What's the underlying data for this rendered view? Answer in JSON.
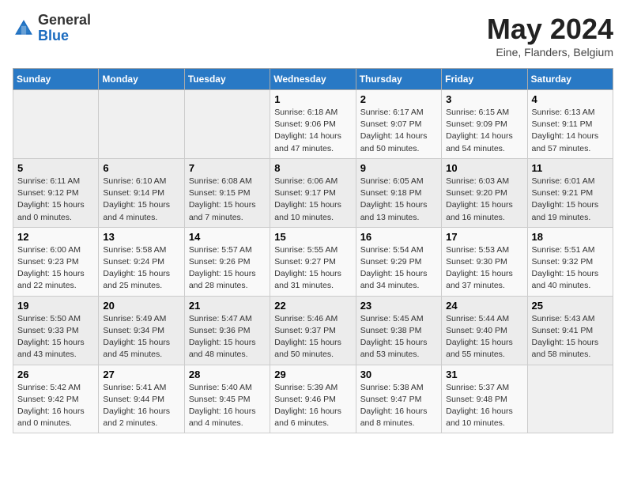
{
  "header": {
    "logo_general": "General",
    "logo_blue": "Blue",
    "main_title": "May 2024",
    "subtitle": "Eine, Flanders, Belgium"
  },
  "weekdays": [
    "Sunday",
    "Monday",
    "Tuesday",
    "Wednesday",
    "Thursday",
    "Friday",
    "Saturday"
  ],
  "rows": [
    [
      {
        "day": "",
        "empty": true
      },
      {
        "day": "",
        "empty": true
      },
      {
        "day": "",
        "empty": true
      },
      {
        "day": "1",
        "sunrise": "6:18 AM",
        "sunset": "9:06 PM",
        "daylight": "14 hours and 47 minutes."
      },
      {
        "day": "2",
        "sunrise": "6:17 AM",
        "sunset": "9:07 PM",
        "daylight": "14 hours and 50 minutes."
      },
      {
        "day": "3",
        "sunrise": "6:15 AM",
        "sunset": "9:09 PM",
        "daylight": "14 hours and 54 minutes."
      },
      {
        "day": "4",
        "sunrise": "6:13 AM",
        "sunset": "9:11 PM",
        "daylight": "14 hours and 57 minutes."
      }
    ],
    [
      {
        "day": "5",
        "sunrise": "6:11 AM",
        "sunset": "9:12 PM",
        "daylight": "15 hours and 0 minutes."
      },
      {
        "day": "6",
        "sunrise": "6:10 AM",
        "sunset": "9:14 PM",
        "daylight": "15 hours and 4 minutes."
      },
      {
        "day": "7",
        "sunrise": "6:08 AM",
        "sunset": "9:15 PM",
        "daylight": "15 hours and 7 minutes."
      },
      {
        "day": "8",
        "sunrise": "6:06 AM",
        "sunset": "9:17 PM",
        "daylight": "15 hours and 10 minutes."
      },
      {
        "day": "9",
        "sunrise": "6:05 AM",
        "sunset": "9:18 PM",
        "daylight": "15 hours and 13 minutes."
      },
      {
        "day": "10",
        "sunrise": "6:03 AM",
        "sunset": "9:20 PM",
        "daylight": "15 hours and 16 minutes."
      },
      {
        "day": "11",
        "sunrise": "6:01 AM",
        "sunset": "9:21 PM",
        "daylight": "15 hours and 19 minutes."
      }
    ],
    [
      {
        "day": "12",
        "sunrise": "6:00 AM",
        "sunset": "9:23 PM",
        "daylight": "15 hours and 22 minutes."
      },
      {
        "day": "13",
        "sunrise": "5:58 AM",
        "sunset": "9:24 PM",
        "daylight": "15 hours and 25 minutes."
      },
      {
        "day": "14",
        "sunrise": "5:57 AM",
        "sunset": "9:26 PM",
        "daylight": "15 hours and 28 minutes."
      },
      {
        "day": "15",
        "sunrise": "5:55 AM",
        "sunset": "9:27 PM",
        "daylight": "15 hours and 31 minutes."
      },
      {
        "day": "16",
        "sunrise": "5:54 AM",
        "sunset": "9:29 PM",
        "daylight": "15 hours and 34 minutes."
      },
      {
        "day": "17",
        "sunrise": "5:53 AM",
        "sunset": "9:30 PM",
        "daylight": "15 hours and 37 minutes."
      },
      {
        "day": "18",
        "sunrise": "5:51 AM",
        "sunset": "9:32 PM",
        "daylight": "15 hours and 40 minutes."
      }
    ],
    [
      {
        "day": "19",
        "sunrise": "5:50 AM",
        "sunset": "9:33 PM",
        "daylight": "15 hours and 43 minutes."
      },
      {
        "day": "20",
        "sunrise": "5:49 AM",
        "sunset": "9:34 PM",
        "daylight": "15 hours and 45 minutes."
      },
      {
        "day": "21",
        "sunrise": "5:47 AM",
        "sunset": "9:36 PM",
        "daylight": "15 hours and 48 minutes."
      },
      {
        "day": "22",
        "sunrise": "5:46 AM",
        "sunset": "9:37 PM",
        "daylight": "15 hours and 50 minutes."
      },
      {
        "day": "23",
        "sunrise": "5:45 AM",
        "sunset": "9:38 PM",
        "daylight": "15 hours and 53 minutes."
      },
      {
        "day": "24",
        "sunrise": "5:44 AM",
        "sunset": "9:40 PM",
        "daylight": "15 hours and 55 minutes."
      },
      {
        "day": "25",
        "sunrise": "5:43 AM",
        "sunset": "9:41 PM",
        "daylight": "15 hours and 58 minutes."
      }
    ],
    [
      {
        "day": "26",
        "sunrise": "5:42 AM",
        "sunset": "9:42 PM",
        "daylight": "16 hours and 0 minutes."
      },
      {
        "day": "27",
        "sunrise": "5:41 AM",
        "sunset": "9:44 PM",
        "daylight": "16 hours and 2 minutes."
      },
      {
        "day": "28",
        "sunrise": "5:40 AM",
        "sunset": "9:45 PM",
        "daylight": "16 hours and 4 minutes."
      },
      {
        "day": "29",
        "sunrise": "5:39 AM",
        "sunset": "9:46 PM",
        "daylight": "16 hours and 6 minutes."
      },
      {
        "day": "30",
        "sunrise": "5:38 AM",
        "sunset": "9:47 PM",
        "daylight": "16 hours and 8 minutes."
      },
      {
        "day": "31",
        "sunrise": "5:37 AM",
        "sunset": "9:48 PM",
        "daylight": "16 hours and 10 minutes."
      },
      {
        "day": "",
        "empty": true
      }
    ]
  ]
}
